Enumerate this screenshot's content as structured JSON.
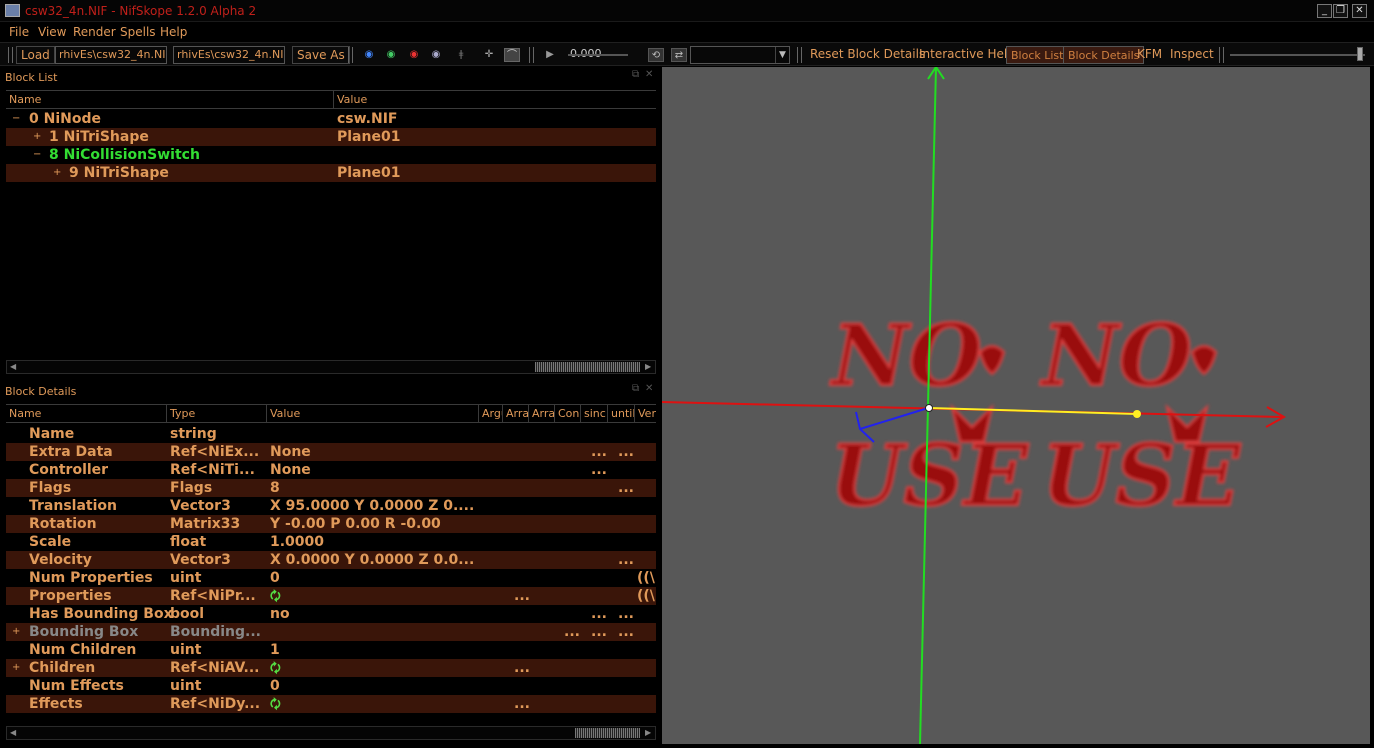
{
  "window": {
    "title": "csw32_4n.NIF - NifSkope 1.2.0 Alpha 2",
    "minimize": "_",
    "maximize": "❐",
    "close": "✕"
  },
  "menu": [
    "File",
    "View",
    "Render",
    "Spells",
    "Help"
  ],
  "toolbar": {
    "load": "Load",
    "load_path": "rhivEs\\csw32_4n.NIF",
    "save_path": "rhivEs\\csw32_4n.NIF",
    "save_as": "Save As",
    "time_value": "0.000",
    "reset_block_details": "Reset Block Details",
    "interactive_help": "Interactive Help",
    "block_list": "Block List",
    "block_details": "Block Details",
    "kfm": "KFM",
    "inspect": "Inspect"
  },
  "block_list": {
    "label": "Block List",
    "columns": [
      "Name",
      "Value"
    ],
    "rows": [
      {
        "expander": "−",
        "name": "0 NiNode",
        "value": "csw.NIF"
      },
      {
        "expander": "+",
        "name": "1 NiTriShape",
        "value": "Plane01"
      },
      {
        "expander": "−",
        "name": "8 NiCollisionSwitch",
        "value": ""
      },
      {
        "expander": "+",
        "name": "9 NiTriShape",
        "value": "Plane01"
      }
    ]
  },
  "block_details": {
    "label": "Block Details",
    "columns": [
      "Name",
      "Type",
      "Value",
      "Argu",
      "Arra",
      "Arra",
      "Con",
      "sinc",
      "until",
      "Vers"
    ],
    "rows": [
      {
        "expander": "",
        "name": "Name",
        "type": "string",
        "value": "",
        "dots": [],
        "extra": ""
      },
      {
        "expander": "",
        "name": "Extra Data",
        "type": "Ref<NiEx...",
        "value": "None",
        "dots": [
          "...",
          "..."
        ],
        "extra": ""
      },
      {
        "expander": "",
        "name": "Controller",
        "type": "Ref<NiTi...",
        "value": "None",
        "dots": [
          "..."
        ],
        "extra": ""
      },
      {
        "expander": "",
        "name": "Flags",
        "type": "Flags",
        "value": "8",
        "dots": [
          "..."
        ],
        "extra": ""
      },
      {
        "expander": "",
        "name": "Translation",
        "type": "Vector3",
        "value": "X 95.0000 Y 0.0000 Z 0....",
        "dots": [],
        "extra": ""
      },
      {
        "expander": "",
        "name": "Rotation",
        "type": "Matrix33",
        "value": "Y -0.00 P 0.00 R -0.00",
        "dots": [],
        "extra": ""
      },
      {
        "expander": "",
        "name": "Scale",
        "type": "float",
        "value": "1.0000",
        "dots": [],
        "extra": ""
      },
      {
        "expander": "",
        "name": "Velocity",
        "type": "Vector3",
        "value": "X 0.0000 Y 0.0000 Z 0.0...",
        "dots": [
          "..."
        ],
        "extra": ""
      },
      {
        "expander": "",
        "name": "Num Properties",
        "type": "uint",
        "value": "0",
        "dots": [],
        "extra": "((\\"
      },
      {
        "expander": "",
        "name": "Properties",
        "type": "Ref<NiPr...",
        "value": "🗘",
        "dots": [
          "..."
        ],
        "extra": "((\\"
      },
      {
        "expander": "",
        "name": "Has Bounding Box",
        "type": "bool",
        "value": "no",
        "dots": [
          "...",
          "..."
        ],
        "extra": ""
      },
      {
        "expander": "+",
        "name": "Bounding Box",
        "type": "Bounding...",
        "value": "",
        "dots": [
          "...",
          "...",
          "..."
        ],
        "extra": "",
        "disabled": true
      },
      {
        "expander": "",
        "name": "Num Children",
        "type": "uint",
        "value": "1",
        "dots": [],
        "extra": ""
      },
      {
        "expander": "+",
        "name": "Children",
        "type": "Ref<NiAV...",
        "value": "🗘",
        "dots": [
          "..."
        ],
        "extra": ""
      },
      {
        "expander": "",
        "name": "Num Effects",
        "type": "uint",
        "value": "0",
        "dots": [],
        "extra": ""
      },
      {
        "expander": "",
        "name": "Effects",
        "type": "Ref<NiDy...",
        "value": "🗘",
        "dots": [
          "..."
        ],
        "extra": ""
      }
    ]
  },
  "viewport": {
    "texture_text": [
      "NO",
      "NO",
      "USE",
      "USE"
    ],
    "colors": {
      "background": "#585858",
      "x_axis": "#dd1111",
      "y_axis": "#22dd22",
      "z_axis": "#2222ee",
      "gizmo": "#ffee22",
      "texture": "#aa1010"
    }
  }
}
